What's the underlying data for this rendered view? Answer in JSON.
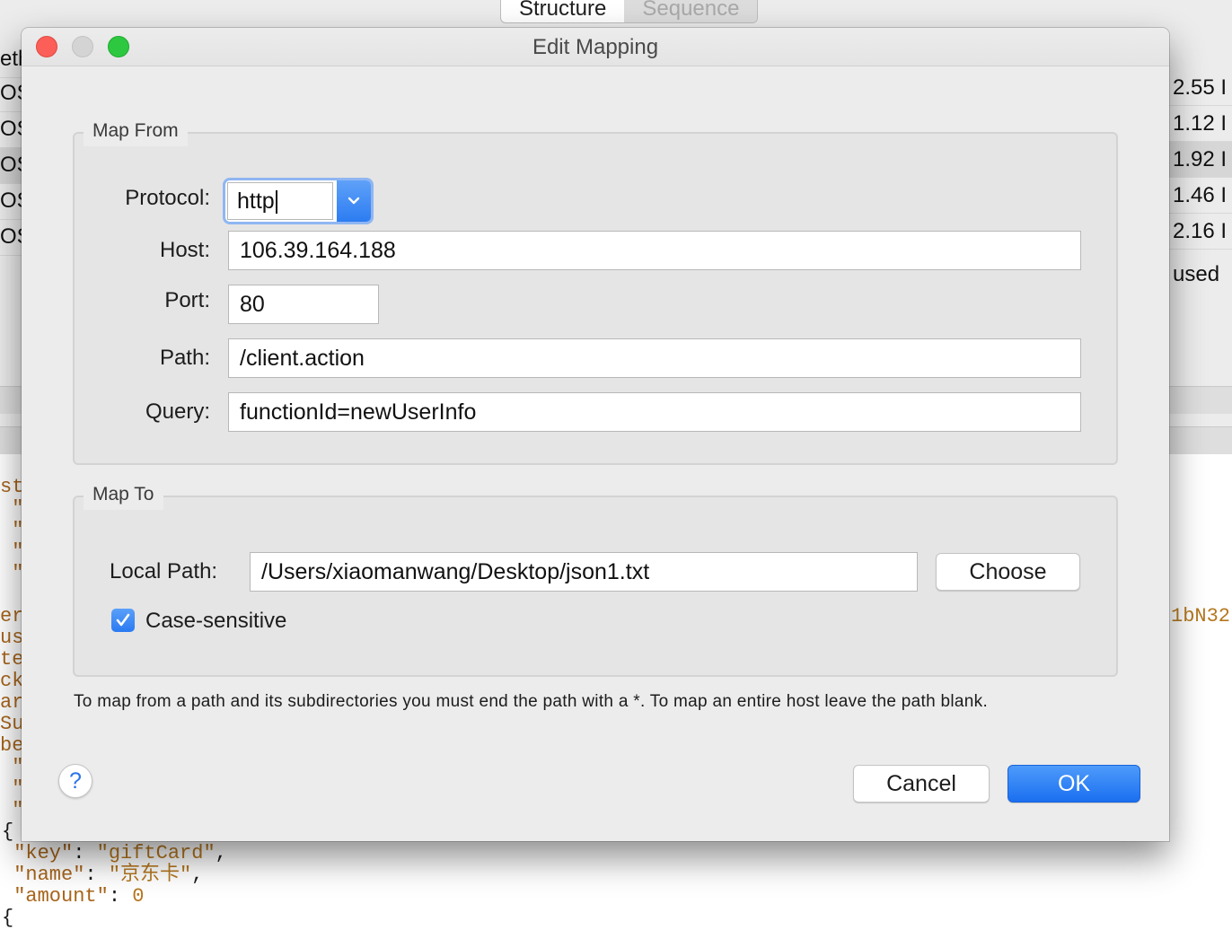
{
  "background": {
    "tabs": [
      "Structure",
      "Sequence"
    ],
    "left_rows": [
      "eth",
      "OS",
      "OS",
      "OS",
      "OS",
      "OS"
    ],
    "right_rows": [
      "2.55 I",
      "1.12 I",
      "1.92 I",
      "1.46 I",
      "2.16 I"
    ],
    "right_used": "used",
    "right_code": "1bN32",
    "left_code": [
      "st",
      " \"",
      " \"",
      " \"",
      " \"",
      "",
      "er",
      "us",
      "te",
      "ck",
      "ar",
      "Su",
      "be",
      " \"",
      " \"",
      " \""
    ],
    "json_snippet": {
      "brace_open": "{",
      "key_label": "\"key\"",
      "key_value": "\"giftCard\"",
      "name_label": "\"name\"",
      "name_value": "\"京东卡\"",
      "amount_label": "\"amount\"",
      "amount_value": "0",
      "brace_next": "{"
    }
  },
  "dialog": {
    "title": "Edit Mapping",
    "map_from": {
      "legend": "Map From",
      "protocol_label": "Protocol:",
      "protocol_value": "http",
      "host_label": "Host:",
      "host_value": "106.39.164.188",
      "port_label": "Port:",
      "port_value": "80",
      "path_label": "Path:",
      "path_value": "/client.action",
      "query_label": "Query:",
      "query_value": "functionId=newUserInfo"
    },
    "map_to": {
      "legend": "Map To",
      "local_path_label": "Local Path:",
      "local_path_value": "/Users/xiaomanwang/Desktop/json1.txt",
      "choose_label": "Choose",
      "case_sensitive_label": "Case-sensitive",
      "case_sensitive_checked": true
    },
    "help_text": "To map from a path and its subdirectories you must end the path with a *. To map an entire host leave the path blank.",
    "help_button": "?",
    "cancel_label": "Cancel",
    "ok_label": "OK"
  },
  "colors": {
    "accent": "#2c7cf2",
    "close": "#fc5f57",
    "zoom": "#2dc840",
    "json_key": "#a8651b"
  }
}
